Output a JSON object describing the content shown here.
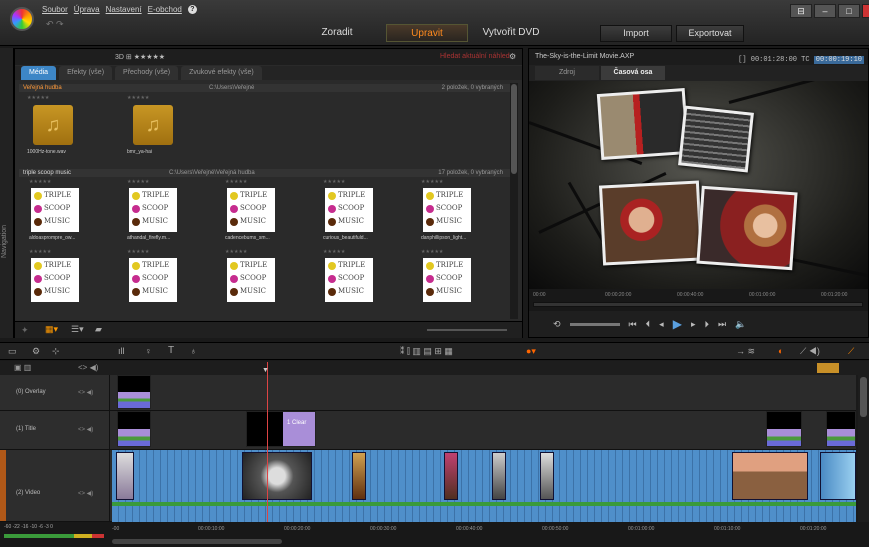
{
  "window": {
    "menu": [
      "Soubor",
      "Úprava",
      "Nastavení",
      "E-obchod"
    ],
    "help_icon": "?",
    "undo_redo": "↶ ↷",
    "tabs": [
      "Zoradit",
      "Upravit",
      "Vytvořit DVD"
    ],
    "active_tab": "Upravit",
    "buttons": {
      "import": "Import",
      "export": "Exportovat"
    },
    "controls": [
      "⊟",
      "–",
      "□",
      "✕"
    ],
    "accent": "#ff8a1e"
  },
  "library": {
    "nav_label": "Navigation",
    "toolbar_left": "3D  ⊞  ★★★★★",
    "search_placeholder": "Hledat aktuální náhled",
    "tabs": [
      "Média",
      "Efekty (vše)",
      "Přechody (vše)",
      "Zvukové efekty (vše)"
    ],
    "active_tab": "Média",
    "sections": [
      {
        "name": "Veřejná hudba",
        "path": "C:\\Users\\Veřejné",
        "count": "2 položek, 0 vybraných",
        "items": [
          "1000Hz-tone.wav",
          "bmr_ya-hai"
        ]
      },
      {
        "name": "triple scoop music",
        "path": "C:\\Users\\Veřejné\\Veřejná hudba",
        "count": "17 položek, 0 vybraných",
        "items": [
          "aldoasprompre_ow...",
          "athandal_firefly.m...",
          "cadencebums_sm...",
          "curious_beautifuld...",
          "danphillipson_light...",
          "",
          "",
          "",
          "",
          ""
        ]
      }
    ],
    "logo_lines": [
      "TRIPLE",
      "SCOOP",
      "MUSIC"
    ],
    "stars": "★★★★★"
  },
  "player": {
    "title": "The-Sky-is-the-Limit Movie.AXP",
    "duration": "[] 00:01:28:00",
    "tc_label": "TC",
    "timecode": "00:00:19:10",
    "tabs": [
      "Zdroj",
      "Časová osa"
    ],
    "active_tab": "Časová osa",
    "ruler": [
      "00:00",
      "00:00:20:00",
      "00:00:40:00",
      "00:01:00:00",
      "00:01:20:00"
    ],
    "controls": [
      "⟲",
      "⏮",
      "⏴",
      "◂",
      "▶",
      "▸",
      "⏵",
      "⏭",
      "🔈"
    ]
  },
  "timeline": {
    "tracks": [
      {
        "name": "(0) Overlay"
      },
      {
        "name": "(1) Title"
      },
      {
        "name": "(2) Video"
      }
    ],
    "track_icons": "<> ◀)",
    "title_clip": "1 Clear",
    "ruler": [
      "-00",
      "00:00:10:00",
      "00:00:20:00",
      "00:00:30:00",
      "00:00:40:00",
      "00:00:50:00",
      "00:01:00:00",
      "00:01:10:00",
      "00:01:20:00"
    ],
    "meter": "-60  -22 -16  -10  -6  -3  0"
  }
}
